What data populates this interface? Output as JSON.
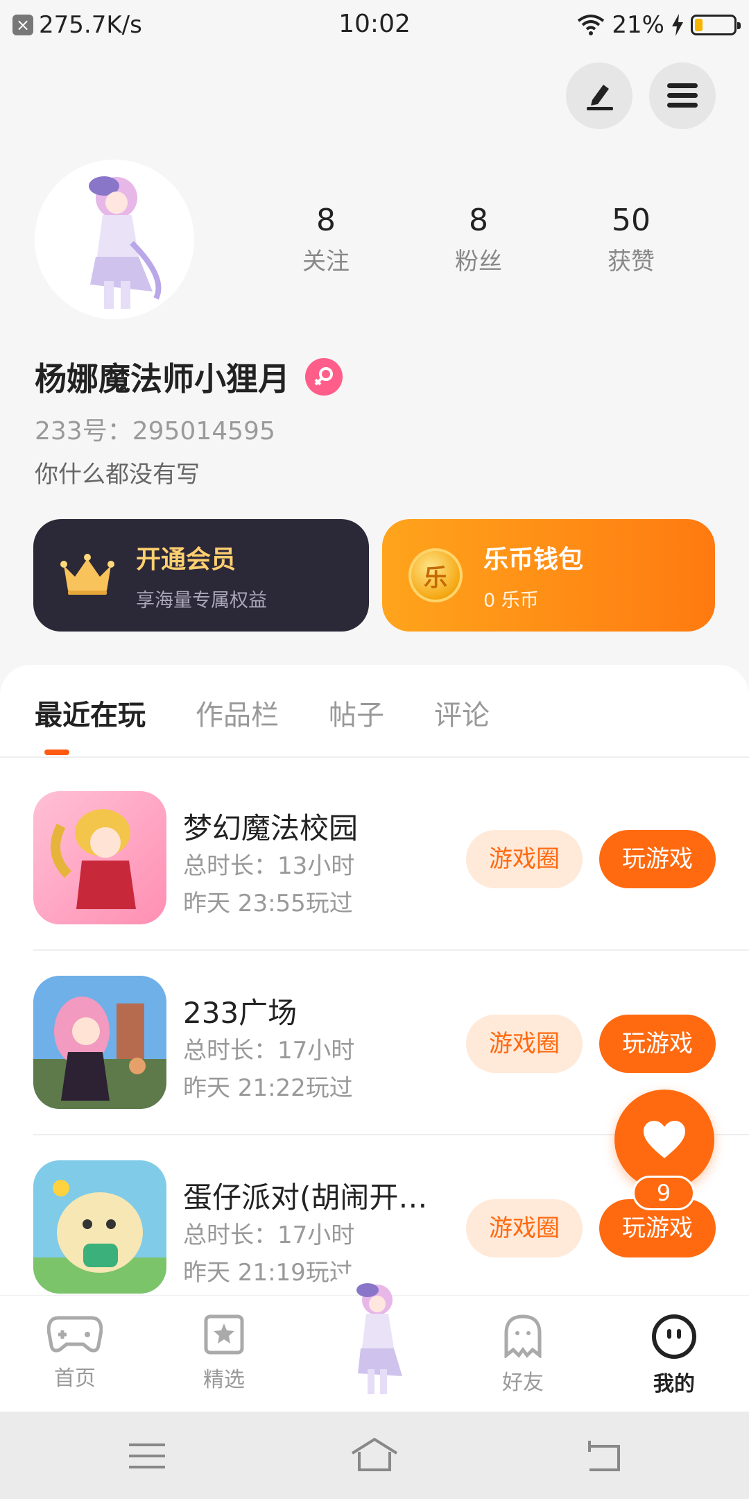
{
  "status_bar": {
    "speed": "275.7K/s",
    "time": "10:02",
    "battery": "21%",
    "battery_level": 0.21
  },
  "profile": {
    "stats": [
      {
        "value": "8",
        "label": "关注"
      },
      {
        "value": "8",
        "label": "粉丝"
      },
      {
        "value": "50",
        "label": "获赞"
      }
    ],
    "name": "杨娜魔法师小狸月",
    "uid": "233号：295014595",
    "bio": "你什么都没有写"
  },
  "cards": {
    "vip": {
      "title": "开通会员",
      "subtitle": "享海量专属权益"
    },
    "wallet": {
      "title": "乐币钱包",
      "subtitle": "0 乐币",
      "coin_glyph": "乐"
    }
  },
  "tabs": [
    {
      "label": "最近在玩",
      "active": true
    },
    {
      "label": "作品栏",
      "active": false
    },
    {
      "label": "帖子",
      "active": false
    },
    {
      "label": "评论",
      "active": false
    }
  ],
  "games": [
    {
      "name": "梦幻魔法校园",
      "duration": "总时长：13小时",
      "last_played": "昨天 23:55玩过"
    },
    {
      "name": "233广场",
      "duration": "总时长：17小时",
      "last_played": "昨天 21:22玩过"
    },
    {
      "name": "蛋仔派对(胡闹开…",
      "duration": "总时长：17小时",
      "last_played": "昨天 21:19玩过"
    }
  ],
  "game_buttons": {
    "circle": "游戏圈",
    "play": "玩游戏"
  },
  "like": {
    "count": "9"
  },
  "bottom_nav": [
    {
      "label": "首页",
      "icon": "gamepad-icon"
    },
    {
      "label": "精选",
      "icon": "star-bookmark-icon"
    },
    {
      "label": "",
      "icon": "avatar-center"
    },
    {
      "label": "好友",
      "icon": "ghost-icon"
    },
    {
      "label": "我的",
      "icon": "smiley-icon",
      "active": true
    }
  ],
  "colors": {
    "accent": "#ff6a10",
    "vip_bg": "#2b2838",
    "vip_text": "#ffcf70",
    "gender_pink": "#ff5e8a"
  }
}
